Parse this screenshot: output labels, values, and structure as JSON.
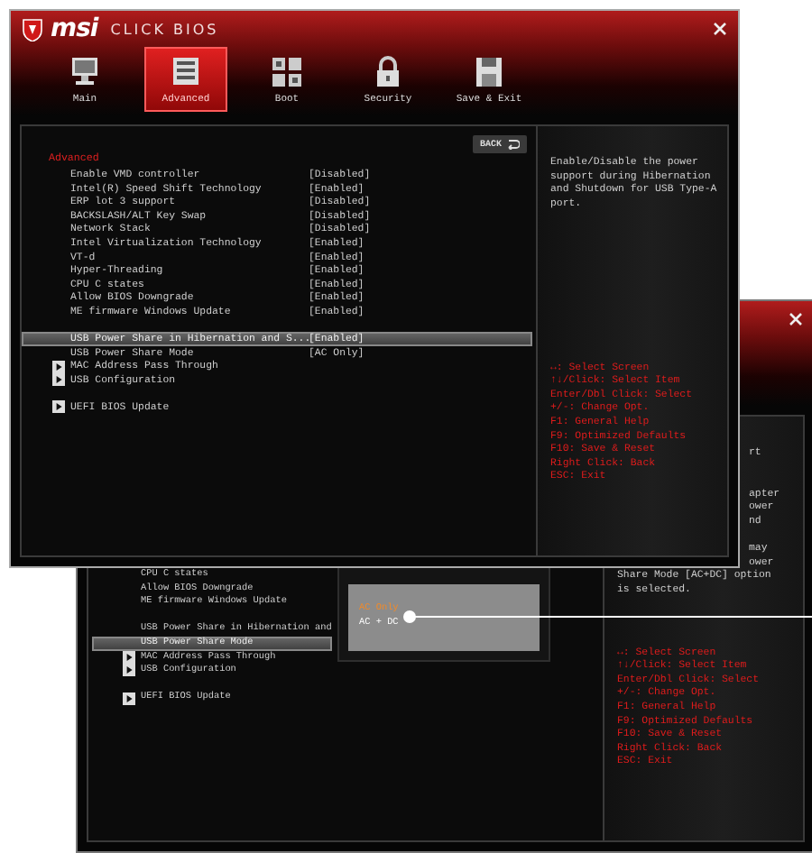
{
  "back_window": {
    "items": [
      {
        "kind": "setting",
        "label": "CPU C states",
        "selected": false
      },
      {
        "kind": "setting",
        "label": "Allow BIOS Downgrade",
        "selected": false
      },
      {
        "kind": "setting",
        "label": "ME firmware Windows Update",
        "selected": false
      },
      {
        "kind": "spacer"
      },
      {
        "kind": "setting",
        "label": "USB Power Share in Hibernation and",
        "selected": false
      },
      {
        "kind": "setting",
        "label": "USB Power Share Mode",
        "selected": true
      },
      {
        "kind": "submenu",
        "label": "MAC Address Pass Through"
      },
      {
        "kind": "submenu",
        "label": "USB Configuration"
      },
      {
        "kind": "spacer"
      },
      {
        "kind": "submenu",
        "label": "UEFI BIOS Update"
      }
    ],
    "popup": {
      "options": [
        {
          "label": "AC Only",
          "selected": false
        },
        {
          "label": "AC + DC",
          "selected": true
        }
      ]
    },
    "help_lines": [
      {
        "kind": "cut",
        "text": "rt"
      },
      {
        "kind": "blank"
      },
      {
        "kind": "blank"
      },
      {
        "kind": "cut",
        "text": "apter"
      },
      {
        "kind": "cut",
        "text": "ower"
      },
      {
        "kind": "cut",
        "text": "nd"
      },
      {
        "kind": "blank"
      },
      {
        "kind": "cut",
        "text": "may"
      },
      {
        "kind": "cut",
        "text": "ower"
      },
      {
        "kind": "full",
        "text": "Share Mode [AC+DC] option"
      },
      {
        "kind": "full",
        "text": "is selected."
      }
    ],
    "keys": [
      "↔: Select Screen",
      "↑↓/Click: Select Item",
      "Enter/Dbl Click: Select",
      "+/-: Change Opt.",
      "F1: General Help",
      "F9: Optimized Defaults",
      "F10: Save & Reset",
      "Right Click: Back",
      "ESC: Exit"
    ]
  },
  "front_window": {
    "logo": "msi",
    "title": "CLICK BIOS",
    "tabs": [
      {
        "label": "Main",
        "selected": false
      },
      {
        "label": "Advanced",
        "selected": true
      },
      {
        "label": "Boot",
        "selected": false
      },
      {
        "label": "Security",
        "selected": false
      },
      {
        "label": "Save & Exit",
        "selected": false
      }
    ],
    "back_button": "BACK",
    "section": "Advanced",
    "items": [
      {
        "kind": "setting",
        "label": "Enable VMD controller",
        "value": "[Disabled]",
        "selected": false
      },
      {
        "kind": "setting",
        "label": "Intel(R) Speed Shift Technology",
        "value": "[Enabled]",
        "selected": false
      },
      {
        "kind": "setting",
        "label": "ERP lot 3 support",
        "value": "[Disabled]",
        "selected": false
      },
      {
        "kind": "setting",
        "label": "BACKSLASH/ALT Key Swap",
        "value": "[Disabled]",
        "selected": false
      },
      {
        "kind": "setting",
        "label": "Network Stack",
        "value": "[Disabled]",
        "selected": false
      },
      {
        "kind": "setting",
        "label": "Intel Virtualization Technology",
        "value": "[Enabled]",
        "selected": false
      },
      {
        "kind": "setting",
        "label": "VT-d",
        "value": "[Enabled]",
        "selected": false
      },
      {
        "kind": "setting",
        "label": "Hyper-Threading",
        "value": "[Enabled]",
        "selected": false
      },
      {
        "kind": "setting",
        "label": "CPU C states",
        "value": "[Enabled]",
        "selected": false
      },
      {
        "kind": "setting",
        "label": "Allow BIOS Downgrade",
        "value": "[Enabled]",
        "selected": false
      },
      {
        "kind": "setting",
        "label": "ME firmware Windows Update",
        "value": "[Enabled]",
        "selected": false
      },
      {
        "kind": "spacer"
      },
      {
        "kind": "setting",
        "label": "USB Power Share in Hibernation and S...",
        "value": "[Enabled]",
        "selected": true
      },
      {
        "kind": "setting",
        "label": "USB Power Share Mode",
        "value": "[AC Only]",
        "selected": false
      },
      {
        "kind": "submenu",
        "label": "MAC Address Pass Through"
      },
      {
        "kind": "submenu",
        "label": "USB Configuration"
      },
      {
        "kind": "spacer"
      },
      {
        "kind": "submenu",
        "label": "UEFI BIOS Update"
      }
    ],
    "help": "Enable/Disable the power support during Hibernation and Shutdown for USB Type-A port.",
    "keys": [
      "↔: Select Screen",
      "↑↓/Click: Select Item",
      "Enter/Dbl Click: Select",
      "+/-: Change Opt.",
      "F1: General Help",
      "F9: Optimized Defaults",
      "F10: Save & Reset",
      "Right Click: Back",
      "ESC: Exit"
    ]
  }
}
